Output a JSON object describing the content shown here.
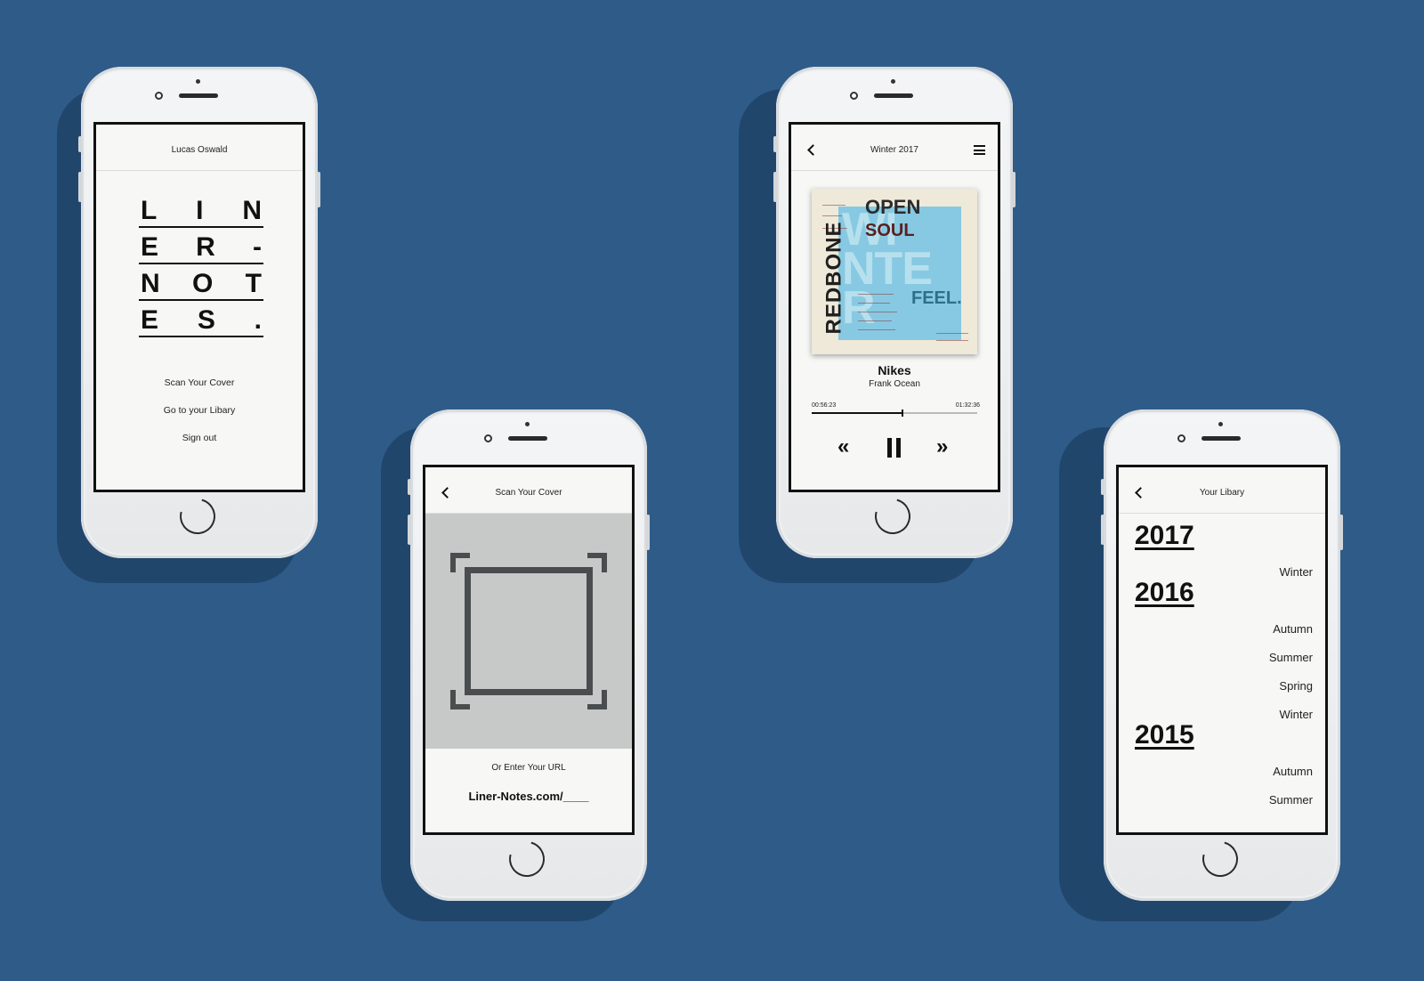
{
  "phone1": {
    "title": "Lucas Oswald",
    "logo_rows": [
      [
        "L",
        "I",
        "N"
      ],
      [
        "E",
        "R",
        "-"
      ],
      [
        "N",
        "O",
        "T"
      ],
      [
        "E",
        "S",
        "."
      ]
    ],
    "menu": {
      "scan": "Scan Your Cover",
      "library": "Go to your Libary",
      "signout": "Sign out"
    }
  },
  "phone2": {
    "title": "Scan Your Cover",
    "url_label": "Or Enter Your URL",
    "url_value": "Liner-Notes.com/____"
  },
  "phone3": {
    "title": "Winter 2017",
    "cover": {
      "open": "OPEN",
      "soul": "SOUL",
      "feel": "FEEL.",
      "side": "REDBONE",
      "big": [
        "WI",
        "NTE",
        "R"
      ]
    },
    "track": "Nikes",
    "artist": "Frank Ocean",
    "elapsed": "00:56:23",
    "total": "01:32:36",
    "progress": 0.55
  },
  "phone4": {
    "title": "Your Libary",
    "years": [
      {
        "year": "2017",
        "seasons": [
          "Winter"
        ]
      },
      {
        "year": "2016",
        "seasons": [
          "Autumn",
          "Summer",
          "Spring",
          "Winter"
        ]
      },
      {
        "year": "2015",
        "seasons": [
          "Autumn",
          "Summer"
        ]
      }
    ]
  }
}
